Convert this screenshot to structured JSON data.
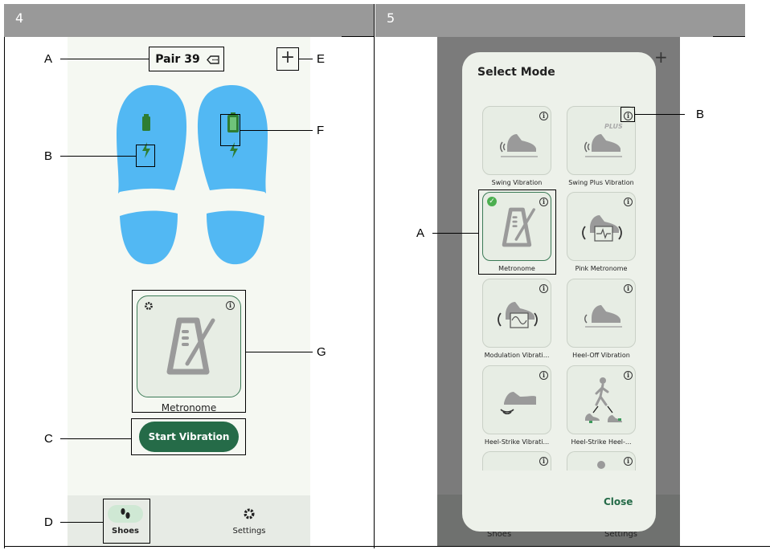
{
  "panels": [
    {
      "number": "4"
    },
    {
      "number": "5"
    }
  ],
  "left": {
    "device_name": "Pair 39",
    "add_symbol": "+",
    "mode_label": "Metronome",
    "start_button": "Start Vibration",
    "nav": [
      {
        "label": "Shoes",
        "icon": "footsteps-icon",
        "active": true
      },
      {
        "label": "Settings",
        "icon": "gear-icon",
        "active": false
      }
    ],
    "callouts": {
      "A": "A",
      "B": "B",
      "C": "C",
      "D": "D",
      "E": "E",
      "F": "F",
      "G": "G"
    },
    "colors": {
      "insole": "#52b8f3",
      "accent": "#256b48",
      "battery": "#2e7d32",
      "background": "#f5f8f2"
    }
  },
  "right": {
    "dialog_title": "Select Mode",
    "close_label": "Close",
    "plus_badge": "PLUS",
    "background_nav": [
      "Shoes",
      "Settings"
    ],
    "modes": [
      {
        "label": "Swing Vibration",
        "selected": false
      },
      {
        "label": "Swing Plus Vibration",
        "selected": false
      },
      {
        "label": "Metronome",
        "selected": true
      },
      {
        "label": "Pink Metronome",
        "selected": false
      },
      {
        "label": "Modulation Vibrati...",
        "selected": false
      },
      {
        "label": "Heel-Off Vibration",
        "selected": false
      },
      {
        "label": "Heel-Strike Vibrati...",
        "selected": false
      },
      {
        "label": "Heel-Strike Heel-...",
        "selected": false
      }
    ],
    "callouts": {
      "A": "A",
      "B": "B"
    }
  }
}
